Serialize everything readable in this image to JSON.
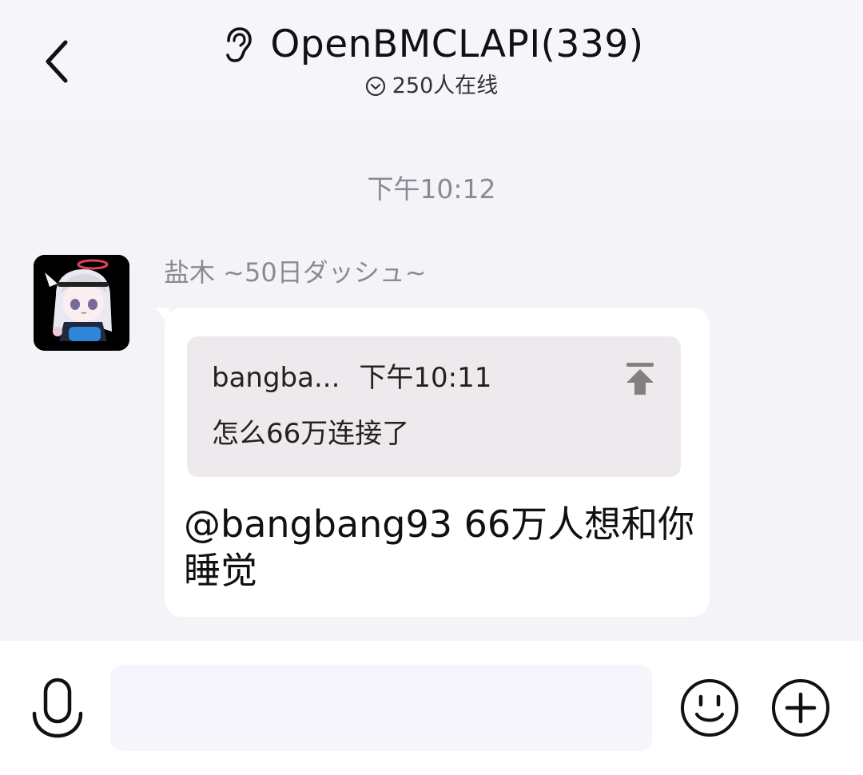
{
  "header": {
    "back_icon": "chevron-left-icon",
    "ear_icon": "ear-icon",
    "title": "OpenBMCLAPI(339)",
    "online_icon": "chevron-down-circle-icon",
    "online_status": "250人在线"
  },
  "chat": {
    "timestamp": "下午10:12",
    "messages": [
      {
        "sender": "盐木 ~50日ダッシュ~",
        "avatar": "anime-character-avatar",
        "reply": {
          "author": "bangba...",
          "time": "下午10:11",
          "text": "怎么66万连接了",
          "jump_icon": "jump-to-top-icon"
        },
        "text": "@bangbang93 66万人想和你睡觉"
      }
    ]
  },
  "input_bar": {
    "mic_icon": "microphone-icon",
    "input_value": "",
    "input_placeholder": "",
    "emoji_icon": "smile-emoji-icon",
    "plus_icon": "plus-circle-icon"
  },
  "colors": {
    "header_bg": "#f6f6fa",
    "chat_bg": "#f4f4f8",
    "bubble_bg": "#ffffff",
    "reply_bg": "#ede9ed",
    "muted_text": "#8a8a96",
    "input_bg": "#f5f5fb"
  }
}
